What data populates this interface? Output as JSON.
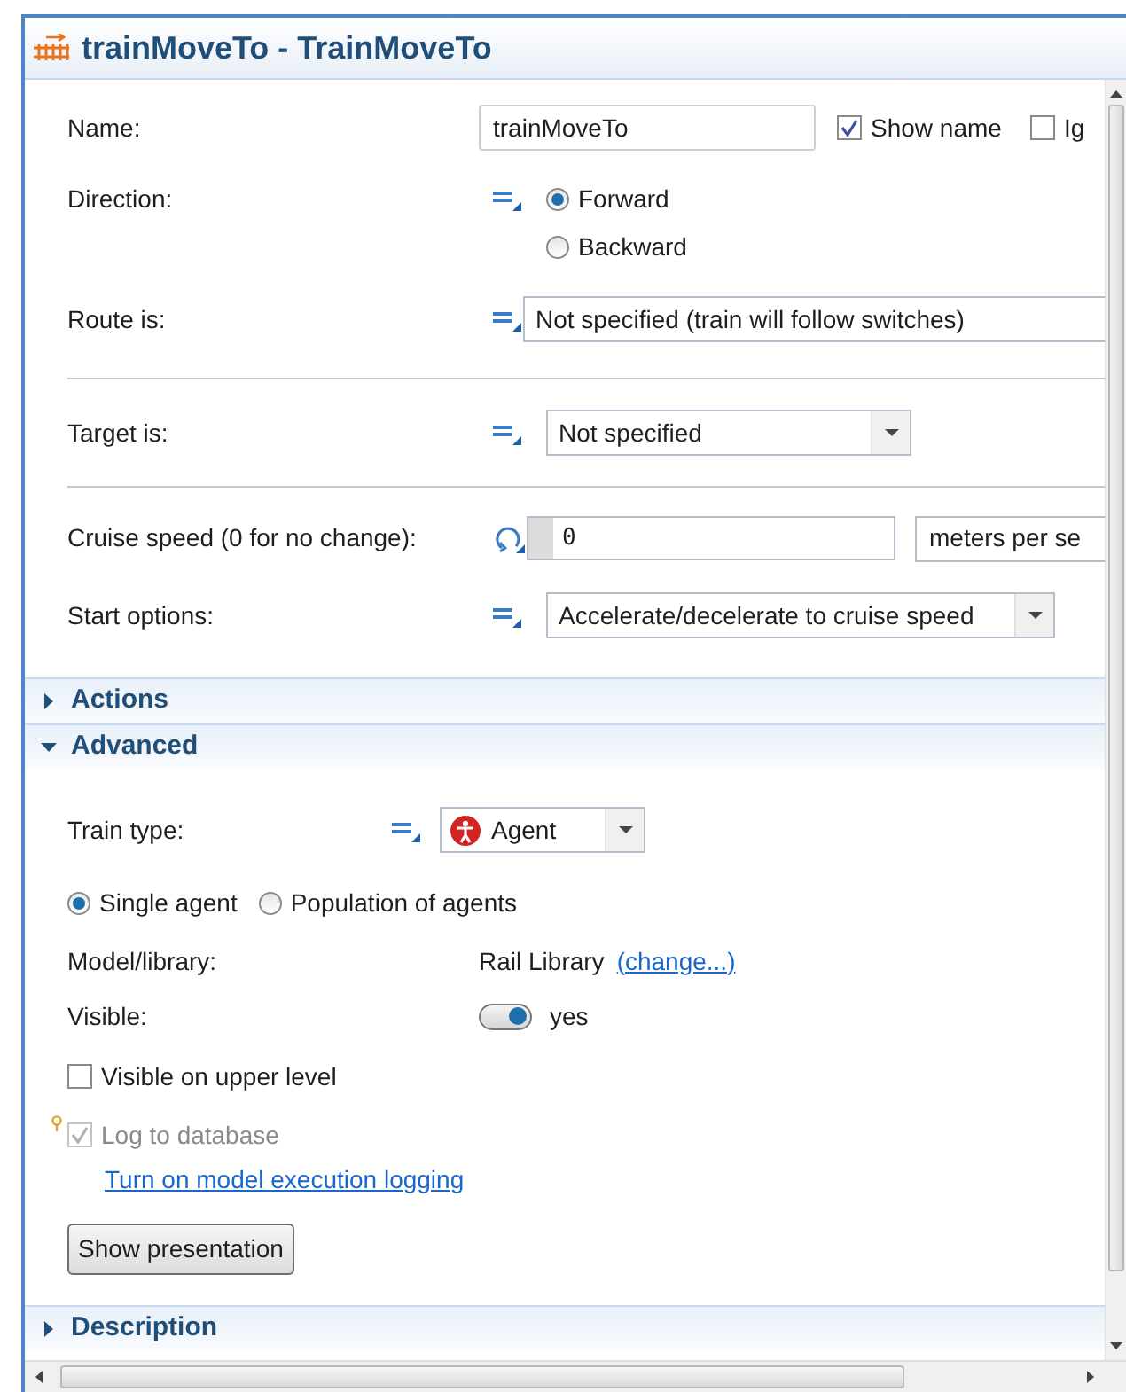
{
  "window": {
    "title": "trainMoveTo - TrainMoveTo"
  },
  "name": {
    "label": "Name:",
    "value": "trainMoveTo",
    "show_name": {
      "label": "Show name",
      "checked": true
    },
    "ignore": {
      "label": "Ig",
      "checked": false
    }
  },
  "direction": {
    "label": "Direction:",
    "options": [
      {
        "label": "Forward",
        "selected": true
      },
      {
        "label": "Backward",
        "selected": false
      }
    ]
  },
  "route": {
    "label": "Route is:",
    "value": "Not specified (train will follow switches)"
  },
  "target": {
    "label": "Target is:",
    "value": "Not specified"
  },
  "cruise_speed": {
    "label": "Cruise speed (0 for no change):",
    "value": "0",
    "unit": "meters per se"
  },
  "start_options": {
    "label": "Start options:",
    "value": "Accelerate/decelerate to cruise speed"
  },
  "sections": [
    {
      "title": "Actions",
      "expanded": false
    },
    {
      "title": "Advanced",
      "expanded": true
    }
  ],
  "advanced": {
    "train_type": {
      "label": "Train type:",
      "value": "Agent"
    },
    "agent_mode": [
      {
        "label": "Single agent",
        "selected": true
      },
      {
        "label": "Population of agents",
        "selected": false
      }
    ],
    "model_library": {
      "label": "Model/library:",
      "value": "Rail Library",
      "link": "(change...)"
    },
    "visible": {
      "label": "Visible:",
      "on": true,
      "value": "yes"
    },
    "visible_upper": {
      "label": "Visible on upper level",
      "checked": false
    },
    "log": {
      "label": "Log to database",
      "checked": true,
      "disabled": true,
      "link": "Turn on model execution logging"
    },
    "button": "Show presentation"
  },
  "description": {
    "title": "Description",
    "expanded": false
  }
}
